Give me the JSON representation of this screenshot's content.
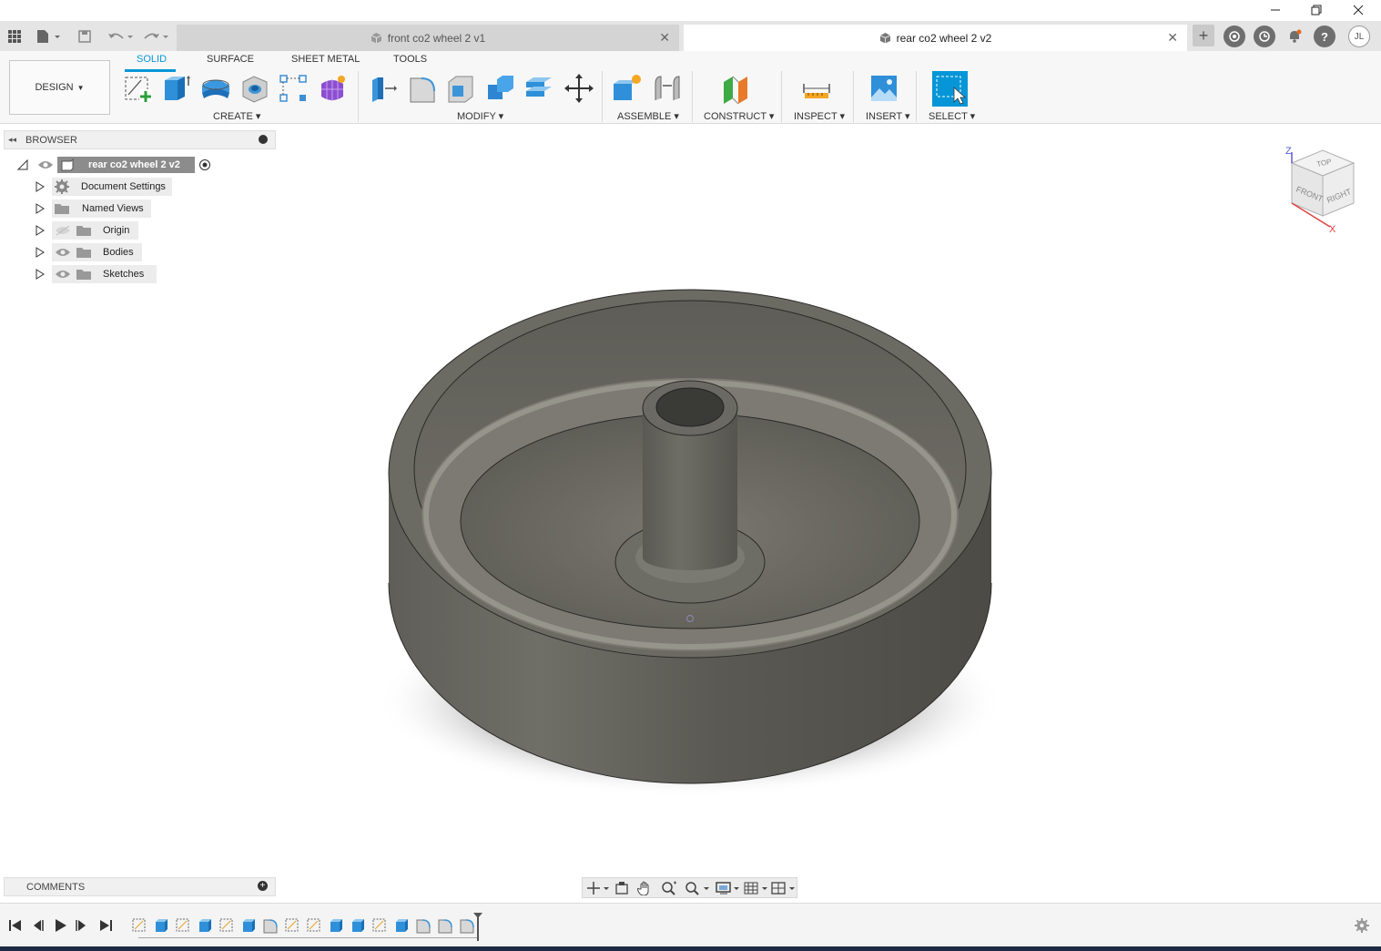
{
  "window": {
    "minimize_icon": "minimize-icon",
    "restore_icon": "restore-icon",
    "close_icon": "close-icon"
  },
  "tabs": [
    {
      "label": "front co2 wheel 2 v1",
      "active": false
    },
    {
      "label": "rear co2 wheel 2 v2",
      "active": true
    }
  ],
  "user": {
    "initials": "JL"
  },
  "toolbar": {
    "workspace": "DESIGN",
    "tabs": [
      "SOLID",
      "SURFACE",
      "SHEET METAL",
      "TOOLS"
    ],
    "groups": {
      "create": "CREATE",
      "modify": "MODIFY",
      "assemble": "ASSEMBLE",
      "construct": "CONSTRUCT",
      "inspect": "INSPECT",
      "insert": "INSERT",
      "select": "SELECT"
    }
  },
  "browser": {
    "title": "BROWSER",
    "root": "rear co2 wheel 2 v2",
    "items": [
      {
        "label": "Document Settings"
      },
      {
        "label": "Named Views"
      },
      {
        "label": "Origin"
      },
      {
        "label": "Bodies"
      },
      {
        "label": "Sketches"
      }
    ]
  },
  "viewcube": {
    "top": "TOP",
    "front": "FRONT",
    "right": "RIGHT",
    "z_axis": "Z",
    "x_axis": "X"
  },
  "comments": {
    "title": "COMMENTS"
  },
  "colors": {
    "accent": "#0696d7",
    "body": "#6b6a63"
  }
}
